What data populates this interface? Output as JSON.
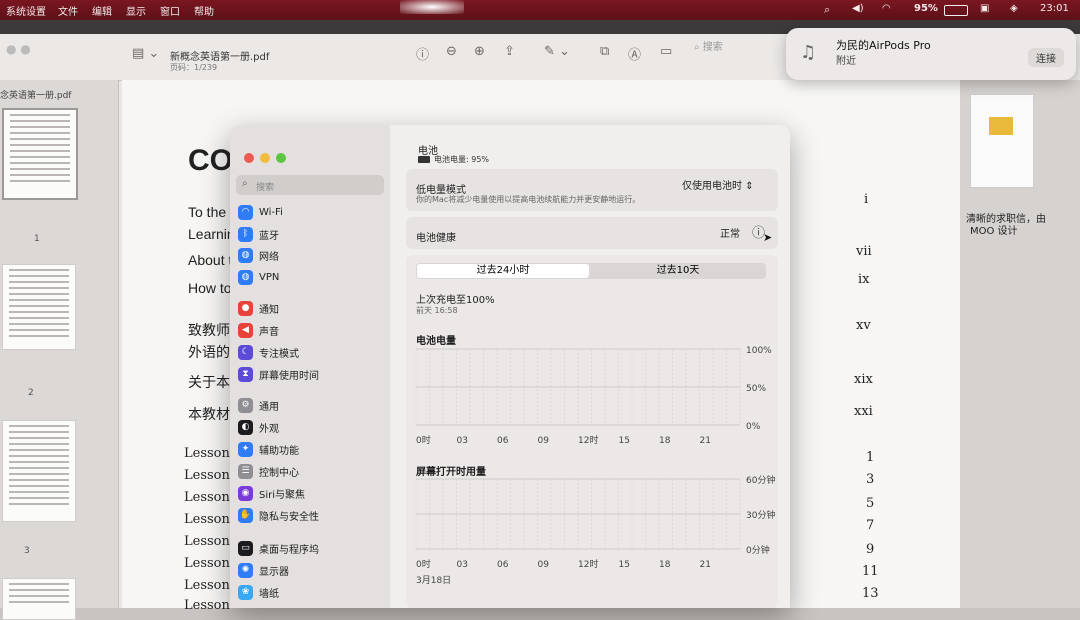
{
  "menubar": {
    "items": [
      "系统设置",
      "文件",
      "编辑",
      "显示",
      "窗口",
      "帮助"
    ],
    "battery_percent": "95%",
    "clock": "23:01"
  },
  "preview": {
    "filename": "新概念英语第一册.pdf",
    "page_info": "页码：1/239",
    "search_placeholder": "搜索",
    "sidebar_title": "念英语第一册.pdf",
    "thumb_numbers": [
      "1",
      "2",
      "3"
    ],
    "doc": {
      "heading": "CO",
      "lines": [
        "To the",
        "Learnin",
        "About t",
        "How to",
        "致教师",
        "外语的",
        "关于本",
        "本教材"
      ],
      "lessons": [
        "Lesson",
        "Lesson",
        "Lesson",
        "Lesson",
        "Lesson",
        "Lesson",
        "Lesson",
        "Lesson"
      ],
      "roman": [
        "i",
        "vii",
        "ix",
        "xv",
        "xix",
        "xxi"
      ],
      "nums": [
        "1",
        "3",
        "5",
        "7",
        "9",
        "11",
        "13"
      ]
    },
    "right_panel": {
      "line1": "清晰的求职信，由",
      "line2": "MOO 设计"
    }
  },
  "notification": {
    "title": "为民的AirPods Pro",
    "subtitle": "附近",
    "action": "连接"
  },
  "settings": {
    "search_placeholder": "搜索",
    "sidebar": [
      {
        "label": "Wi-Fi",
        "icon": "wifi-icon",
        "color": "#2f7cf6"
      },
      {
        "label": "蓝牙",
        "icon": "bluetooth-icon",
        "color": "#2f7cf6"
      },
      {
        "label": "网络",
        "icon": "globe-icon",
        "color": "#2f7cf6"
      },
      {
        "label": "VPN",
        "icon": "vpn-icon",
        "color": "#2f7cf6"
      },
      {
        "label": "通知",
        "icon": "bell-icon",
        "color": "#e8433b"
      },
      {
        "label": "声音",
        "icon": "speaker-icon",
        "color": "#e8433b"
      },
      {
        "label": "专注模式",
        "icon": "moon-icon",
        "color": "#5b4bd6"
      },
      {
        "label": "屏幕使用时间",
        "icon": "hourglass-icon",
        "color": "#5b4bd6"
      },
      {
        "label": "通用",
        "icon": "gear-icon",
        "color": "#8e8e93"
      },
      {
        "label": "外观",
        "icon": "appearance-icon",
        "color": "#1c1c1e"
      },
      {
        "label": "辅助功能",
        "icon": "accessibility-icon",
        "color": "#2f7cf6"
      },
      {
        "label": "控制中心",
        "icon": "control-center-icon",
        "color": "#8e8e93"
      },
      {
        "label": "Siri与聚焦",
        "icon": "siri-icon",
        "color": "#7a3bd8"
      },
      {
        "label": "隐私与安全性",
        "icon": "hand-icon",
        "color": "#2f7cf6"
      },
      {
        "label": "桌面与程序坞",
        "icon": "dock-icon",
        "color": "#1c1c1e"
      },
      {
        "label": "显示器",
        "icon": "display-icon",
        "color": "#2f7cf6"
      },
      {
        "label": "墙纸",
        "icon": "wallpaper-icon",
        "color": "#3aa8f0"
      }
    ],
    "main": {
      "title": "电池",
      "subtitle": "电池电量: 95%",
      "low_power": {
        "label": "低电量模式",
        "desc": "你的Mac将减少电量使用以提高电池续航能力并更安静地运行。",
        "value": "仅使用电池时"
      },
      "health": {
        "label": "电池健康",
        "value": "正常"
      },
      "tabs": [
        "过去24小时",
        "过去10天"
      ],
      "last_charge": {
        "label": "上次充电至100%",
        "time": "前天 16:58"
      }
    }
  },
  "chart_data": [
    {
      "type": "bar",
      "title": "电池电量",
      "categories": [
        "0时",
        "03",
        "06",
        "09",
        "12时",
        "15",
        "18",
        "21"
      ],
      "y_ticks": [
        "100%",
        "50%",
        "0%"
      ],
      "ylim": [
        0,
        100
      ],
      "values": [],
      "grid": true
    },
    {
      "type": "bar",
      "title": "屏幕打开时用量",
      "categories": [
        "0时",
        "03",
        "06",
        "09",
        "12时",
        "15",
        "18",
        "21"
      ],
      "y_ticks": [
        "60分钟",
        "30分钟",
        "0分钟"
      ],
      "ylim": [
        0,
        60
      ],
      "date_label": "3月18日",
      "values": [],
      "grid": true
    }
  ]
}
